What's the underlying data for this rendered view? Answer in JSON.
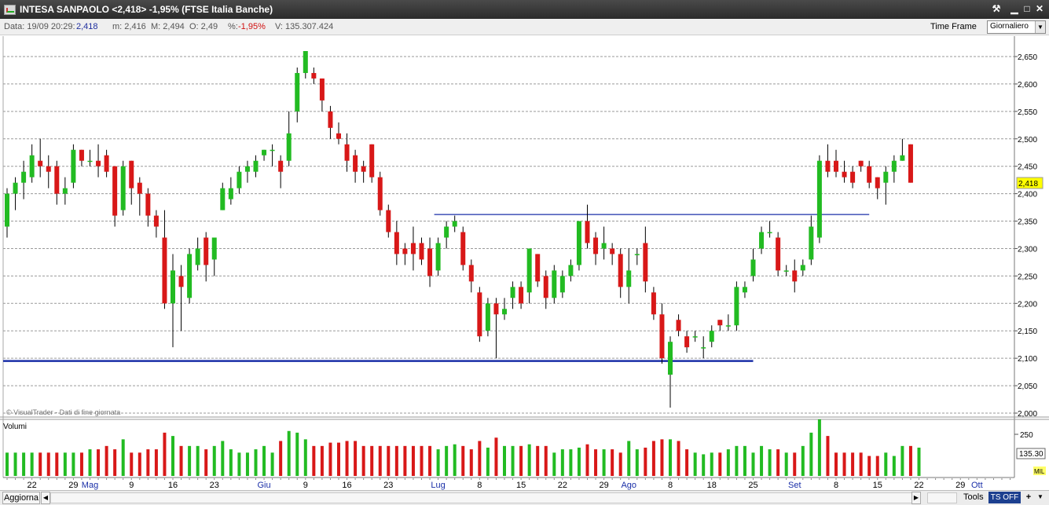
{
  "window": {
    "title": "INTESA SANPAOLO <2,418> -1,95%  (FTSE Italia Banche)",
    "icon": "chart-app-icon",
    "buttons": {
      "tools": "⚒",
      "minimize": "▁",
      "maximize": "□",
      "close": "✕"
    }
  },
  "infobar": {
    "data_label": "Data: 19/09 20:29:",
    "data_value": "2,418",
    "m": "m: 2,416",
    "M": "M: 2,494",
    "O": "O: 2,49",
    "pct_label": "%:",
    "pct_value": "-1,95%",
    "V": "V: 135.307.424",
    "time_frame_label": "Time Frame",
    "time_frame_value": "Giornaliero"
  },
  "chart_panel": {
    "watermark": "© VisualTrader - Dati di fine giornata",
    "current_price_label": "2,418"
  },
  "volume_panel": {
    "label": "Volumi",
    "axis_tick": "250",
    "last_value": "135.30",
    "unit": "MIL"
  },
  "footer": {
    "aggiorna": "Aggiorna",
    "tools": "Tools",
    "ts": "TS OFF",
    "plus": "+"
  },
  "colors": {
    "up": "#22bb22",
    "down": "#d81818",
    "grid": "#9a9a9a",
    "trendline": "#1a2fa8",
    "price_badge": "#ffff00"
  },
  "chart_data": {
    "type": "candlestick",
    "y_ticks": [
      "2,650",
      "2,600",
      "2,550",
      "2,500",
      "2,450",
      "2,400",
      "2,350",
      "2,300",
      "2,250",
      "2,200",
      "2,150",
      "2,100",
      "2,050",
      "2,000"
    ],
    "ylim": [
      2.0,
      2.65
    ],
    "x_labels": [
      {
        "label": "22",
        "idx": 3,
        "month": false
      },
      {
        "label": "29",
        "idx": 8,
        "month": false
      },
      {
        "label": "Mag",
        "idx": 10,
        "month": true
      },
      {
        "label": "9",
        "idx": 15,
        "month": false
      },
      {
        "label": "16",
        "idx": 20,
        "month": false
      },
      {
        "label": "23",
        "idx": 25,
        "month": false
      },
      {
        "label": "Giu",
        "idx": 31,
        "month": true
      },
      {
        "label": "9",
        "idx": 36,
        "month": false
      },
      {
        "label": "16",
        "idx": 41,
        "month": false
      },
      {
        "label": "23",
        "idx": 46,
        "month": false
      },
      {
        "label": "Lug",
        "idx": 52,
        "month": true
      },
      {
        "label": "8",
        "idx": 57,
        "month": false
      },
      {
        "label": "15",
        "idx": 62,
        "month": false
      },
      {
        "label": "22",
        "idx": 67,
        "month": false
      },
      {
        "label": "29",
        "idx": 72,
        "month": false
      },
      {
        "label": "Ago",
        "idx": 75,
        "month": true
      },
      {
        "label": "8",
        "idx": 80,
        "month": false
      },
      {
        "label": "18",
        "idx": 85,
        "month": false
      },
      {
        "label": "25",
        "idx": 90,
        "month": false
      },
      {
        "label": "Set",
        "idx": 95,
        "month": true
      },
      {
        "label": "8",
        "idx": 100,
        "month": false
      },
      {
        "label": "15",
        "idx": 105,
        "month": false
      },
      {
        "label": "22",
        "idx": 110,
        "month": false
      },
      {
        "label": "29",
        "idx": 115,
        "month": false
      },
      {
        "label": "Ott",
        "idx": 117,
        "month": true
      }
    ],
    "candles": [
      [
        2.34,
        2.4,
        2.32,
        2.41
      ],
      [
        2.4,
        2.42,
        2.37,
        2.43
      ],
      [
        2.42,
        2.44,
        2.39,
        2.46
      ],
      [
        2.43,
        2.47,
        2.42,
        2.49
      ],
      [
        2.46,
        2.45,
        2.43,
        2.5
      ],
      [
        2.45,
        2.44,
        2.41,
        2.47
      ],
      [
        2.45,
        2.4,
        2.38,
        2.46
      ],
      [
        2.4,
        2.41,
        2.38,
        2.43
      ],
      [
        2.42,
        2.48,
        2.41,
        2.49
      ],
      [
        2.48,
        2.46,
        2.45,
        2.48
      ],
      [
        2.46,
        2.46,
        2.45,
        2.48
      ],
      [
        2.46,
        2.45,
        2.43,
        2.49
      ],
      [
        2.47,
        2.44,
        2.43,
        2.48
      ],
      [
        2.45,
        2.36,
        2.34,
        2.45
      ],
      [
        2.37,
        2.45,
        2.36,
        2.46
      ],
      [
        2.46,
        2.41,
        2.38,
        2.46
      ],
      [
        2.42,
        2.4,
        2.36,
        2.43
      ],
      [
        2.4,
        2.36,
        2.34,
        2.41
      ],
      [
        2.36,
        2.34,
        2.32,
        2.37
      ],
      [
        2.32,
        2.2,
        2.19,
        2.37
      ],
      [
        2.2,
        2.26,
        2.12,
        2.29
      ],
      [
        2.25,
        2.23,
        2.15,
        2.27
      ],
      [
        2.21,
        2.29,
        2.2,
        2.3
      ],
      [
        2.27,
        2.3,
        2.26,
        2.32
      ],
      [
        2.32,
        2.27,
        2.24,
        2.33
      ],
      [
        2.28,
        2.32,
        2.25,
        2.32
      ],
      [
        2.37,
        2.41,
        2.37,
        2.42
      ],
      [
        2.39,
        2.41,
        2.38,
        2.43
      ],
      [
        2.41,
        2.44,
        2.4,
        2.45
      ],
      [
        2.44,
        2.45,
        2.42,
        2.46
      ],
      [
        2.44,
        2.46,
        2.43,
        2.47
      ],
      [
        2.47,
        2.48,
        2.46,
        2.48
      ],
      [
        2.48,
        2.48,
        2.45,
        2.49
      ],
      [
        2.46,
        2.44,
        2.41,
        2.47
      ],
      [
        2.46,
        2.51,
        2.45,
        2.55
      ],
      [
        2.55,
        2.62,
        2.53,
        2.63
      ],
      [
        2.62,
        2.66,
        2.61,
        2.66
      ],
      [
        2.62,
        2.61,
        2.6,
        2.63
      ],
      [
        2.61,
        2.57,
        2.55,
        2.61
      ],
      [
        2.55,
        2.52,
        2.5,
        2.56
      ],
      [
        2.51,
        2.5,
        2.49,
        2.53
      ],
      [
        2.49,
        2.46,
        2.44,
        2.51
      ],
      [
        2.47,
        2.44,
        2.42,
        2.48
      ],
      [
        2.45,
        2.44,
        2.42,
        2.46
      ],
      [
        2.49,
        2.43,
        2.42,
        2.49
      ],
      [
        2.43,
        2.37,
        2.36,
        2.44
      ],
      [
        2.37,
        2.33,
        2.32,
        2.38
      ],
      [
        2.33,
        2.29,
        2.27,
        2.35
      ],
      [
        2.3,
        2.29,
        2.27,
        2.31
      ],
      [
        2.31,
        2.29,
        2.26,
        2.34
      ],
      [
        2.31,
        2.28,
        2.27,
        2.32
      ],
      [
        2.3,
        2.25,
        2.23,
        2.32
      ],
      [
        2.26,
        2.31,
        2.25,
        2.32
      ],
      [
        2.32,
        2.34,
        2.3,
        2.35
      ],
      [
        2.34,
        2.35,
        2.33,
        2.36
      ],
      [
        2.33,
        2.27,
        2.26,
        2.34
      ],
      [
        2.27,
        2.24,
        2.22,
        2.28
      ],
      [
        2.22,
        2.14,
        2.13,
        2.23
      ],
      [
        2.15,
        2.2,
        2.14,
        2.21
      ],
      [
        2.2,
        2.18,
        2.1,
        2.21
      ],
      [
        2.18,
        2.19,
        2.17,
        2.21
      ],
      [
        2.21,
        2.23,
        2.19,
        2.24
      ],
      [
        2.23,
        2.2,
        2.19,
        2.24
      ],
      [
        2.22,
        2.3,
        2.2,
        2.3
      ],
      [
        2.29,
        2.24,
        2.23,
        2.29
      ],
      [
        2.25,
        2.21,
        2.19,
        2.26
      ],
      [
        2.21,
        2.26,
        2.2,
        2.27
      ],
      [
        2.22,
        2.25,
        2.21,
        2.26
      ],
      [
        2.25,
        2.27,
        2.24,
        2.28
      ],
      [
        2.27,
        2.35,
        2.26,
        2.35
      ],
      [
        2.35,
        2.31,
        2.3,
        2.38
      ],
      [
        2.32,
        2.29,
        2.27,
        2.33
      ],
      [
        2.3,
        2.31,
        2.28,
        2.34
      ],
      [
        2.3,
        2.29,
        2.27,
        2.31
      ],
      [
        2.29,
        2.23,
        2.21,
        2.3
      ],
      [
        2.23,
        2.26,
        2.2,
        2.3
      ],
      [
        2.29,
        2.29,
        2.27,
        2.3
      ],
      [
        2.31,
        2.24,
        2.22,
        2.34
      ],
      [
        2.22,
        2.18,
        2.17,
        2.23
      ],
      [
        2.18,
        2.1,
        2.09,
        2.2
      ],
      [
        2.07,
        2.13,
        2.01,
        2.14
      ],
      [
        2.17,
        2.15,
        2.14,
        2.18
      ],
      [
        2.14,
        2.12,
        2.11,
        2.15
      ],
      [
        2.14,
        2.14,
        2.13,
        2.15
      ],
      [
        2.12,
        2.12,
        2.1,
        2.14
      ],
      [
        2.13,
        2.15,
        2.12,
        2.16
      ],
      [
        2.17,
        2.16,
        2.15,
        2.17
      ],
      [
        2.16,
        2.16,
        2.15,
        2.18
      ],
      [
        2.16,
        2.23,
        2.15,
        2.24
      ],
      [
        2.22,
        2.23,
        2.21,
        2.24
      ],
      [
        2.25,
        2.28,
        2.24,
        2.3
      ],
      [
        2.3,
        2.33,
        2.29,
        2.34
      ],
      [
        2.33,
        2.33,
        2.32,
        2.35
      ],
      [
        2.32,
        2.26,
        2.25,
        2.33
      ],
      [
        2.26,
        2.26,
        2.25,
        2.27
      ],
      [
        2.26,
        2.24,
        2.22,
        2.28
      ],
      [
        2.26,
        2.27,
        2.25,
        2.28
      ],
      [
        2.28,
        2.34,
        2.27,
        2.36
      ],
      [
        2.32,
        2.46,
        2.31,
        2.47
      ],
      [
        2.46,
        2.44,
        2.43,
        2.49
      ],
      [
        2.46,
        2.44,
        2.43,
        2.48
      ],
      [
        2.44,
        2.43,
        2.42,
        2.46
      ],
      [
        2.44,
        2.42,
        2.41,
        2.45
      ],
      [
        2.46,
        2.45,
        2.44,
        2.46
      ],
      [
        2.45,
        2.42,
        2.41,
        2.46
      ],
      [
        2.43,
        2.41,
        2.39,
        2.43
      ],
      [
        2.42,
        2.44,
        2.38,
        2.45
      ],
      [
        2.44,
        2.46,
        2.42,
        2.47
      ],
      [
        2.46,
        2.47,
        2.46,
        2.5
      ],
      [
        2.49,
        2.42,
        2.42,
        2.49
      ]
    ],
    "volumes": [
      0.14,
      0.14,
      0.14,
      0.14,
      0.14,
      0.14,
      0.14,
      0.14,
      0.14,
      0.14,
      0.16,
      0.16,
      0.18,
      0.16,
      0.22,
      0.14,
      0.14,
      0.16,
      0.16,
      0.26,
      0.24,
      0.18,
      0.18,
      0.18,
      0.16,
      0.18,
      0.21,
      0.16,
      0.14,
      0.14,
      0.16,
      0.18,
      0.14,
      0.21,
      0.27,
      0.26,
      0.22,
      0.18,
      0.18,
      0.2,
      0.2,
      0.21,
      0.21,
      0.18,
      0.18,
      0.18,
      0.18,
      0.18,
      0.18,
      0.18,
      0.18,
      0.18,
      0.16,
      0.18,
      0.19,
      0.18,
      0.16,
      0.21,
      0.17,
      0.23,
      0.18,
      0.18,
      0.18,
      0.19,
      0.18,
      0.18,
      0.14,
      0.16,
      0.16,
      0.17,
      0.19,
      0.16,
      0.16,
      0.16,
      0.14,
      0.21,
      0.16,
      0.17,
      0.21,
      0.22,
      0.22,
      0.21,
      0.16,
      0.14,
      0.13,
      0.14,
      0.14,
      0.16,
      0.18,
      0.18,
      0.14,
      0.18,
      0.16,
      0.16,
      0.14,
      0.14,
      0.18,
      0.26,
      0.34,
      0.24,
      0.14,
      0.14,
      0.14,
      0.14,
      0.12,
      0.12,
      0.14,
      0.12,
      0.18,
      0.18,
      0.17
    ],
    "trendlines": [
      {
        "from_idx": 0,
        "to_idx": 90,
        "value": 2.095
      },
      {
        "from_idx": 52,
        "to_idx": 104,
        "value": 2.362
      }
    ]
  }
}
